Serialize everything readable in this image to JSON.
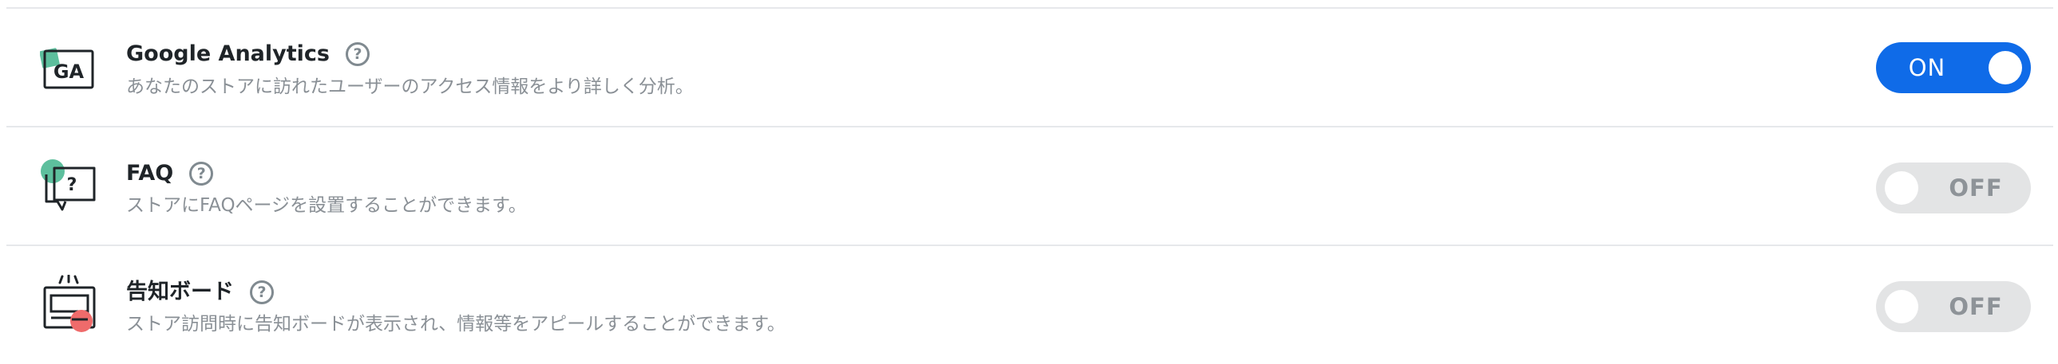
{
  "colors": {
    "accent": "#0f6be8",
    "toggle_off_bg": "#e3e4e5",
    "icon_green": "#5dbf9d",
    "icon_red": "#ef6b6b",
    "title_text": "#1f2428",
    "desc_text": "#8a9096",
    "divider": "#e6e8eb"
  },
  "help_glyph": "?",
  "apps": [
    {
      "icon": "google-analytics-icon",
      "icon_text": "GA",
      "title": "Google Analytics",
      "description": "あなたのストアに訪れたユーザーのアクセス情報をより詳しく分析。",
      "enabled": true,
      "toggle_label": "ON"
    },
    {
      "icon": "faq-chat-bubble-icon",
      "icon_text": "?",
      "title": "FAQ",
      "description": "ストアにFAQページを設置することができます。",
      "enabled": false,
      "toggle_label": "OFF"
    },
    {
      "icon": "notice-board-icon",
      "title": "告知ボード",
      "description": "ストア訪問時に告知ボードが表示され、情報等をアピールすることができます。",
      "enabled": false,
      "toggle_label": "OFF"
    }
  ]
}
